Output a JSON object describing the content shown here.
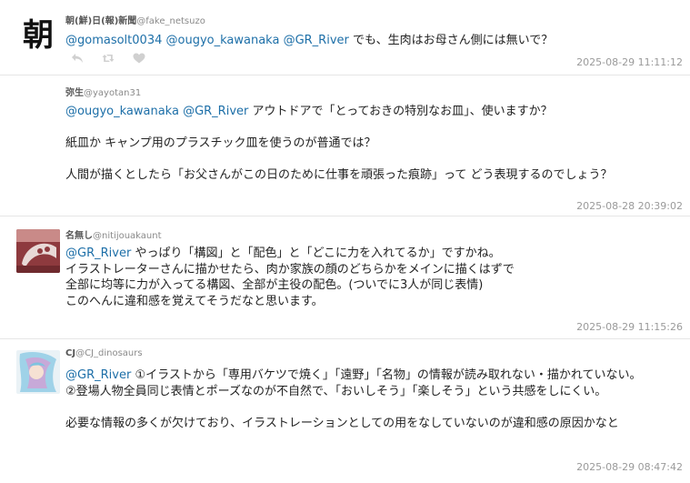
{
  "tweets": [
    {
      "name": "朝(鮮)日(報)新聞",
      "handle": "@fake_netsuzo",
      "avatar_glyph": "朝",
      "mentions": [
        "@gomasolt0034",
        "@ougyo_kawanaka",
        "@GR_River"
      ],
      "lines": [
        "でも、生肉はお母さん側には無いで？"
      ],
      "time": "2025-08-29 11:11:12"
    },
    {
      "name": "弥生",
      "handle": "@yayotan31",
      "mentions": [
        "@ougyo_kawanaka",
        "@GR_River"
      ],
      "lines": [
        "アウトドアで「とっておきの特別なお皿」、使いますか？",
        "",
        "紙皿か キャンプ用のプラスチック皿を使うのが普通では？",
        "",
        "人間が描くとしたら「お父さんがこの日のために仕事を頑張った痕跡」って どう表現するのでしょう？"
      ],
      "time": "2025-08-28 20:39:02"
    },
    {
      "name": "名無し",
      "handle": "@nitijouakaunt",
      "mentions": [
        "@GR_River"
      ],
      "lines": [
        "やっぱり「構図」と「配色」と「どこに力を入れてるか」ですかね。",
        "イラストレーターさんに描かせたら、肉か家族の顔のどちらかをメインに描くはずで",
        "全部に均等に力が入ってる構図、全部が主役の配色。(ついでに3人が同じ表情)",
        "このへんに違和感を覚えてそうだなと思います。"
      ],
      "time": "2025-08-29 11:15:26"
    },
    {
      "name": "CJ",
      "handle": "@CJ_dinosaurs",
      "mentions": [
        "@GR_River"
      ],
      "lines": [
        "①イラストから「専用バケツで焼く」「遠野」「名物」の情報が読み取れない・描かれていない。",
        "②登場人物全員同じ表情とポーズなのが不自然で、「おいしそう」「楽しそう」という共感をしにくい。",
        "",
        "必要な情報の多くが欠けており、イラストレーションとしての用をなしていないのが違和感の原因かなと"
      ],
      "time": "2025-08-29 08:47:42"
    }
  ],
  "icons": [
    "reply-icon",
    "retweet-icon",
    "like-icon"
  ],
  "colors": {
    "mention": "#1d6fa8",
    "timestamp": "#9a9a9a",
    "icon": "#d0d0d0"
  }
}
